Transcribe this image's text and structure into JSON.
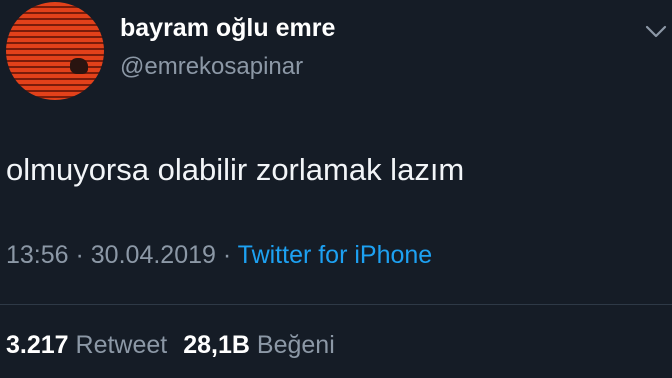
{
  "author": {
    "display_name": "bayram oğlu emre",
    "handle": "@emrekosapinar",
    "avatar_icon": "avatar-image"
  },
  "tweet": {
    "text": "olmuyorsa olabilir zorlamak lazım",
    "time": "13:56",
    "separator": " · ",
    "date": "30.04.2019",
    "source": "Twitter for iPhone"
  },
  "stats": {
    "retweets_count": "3.217",
    "retweets_label": "Retweet",
    "likes_count": "28,1B",
    "likes_label": "Beğeni"
  },
  "colors": {
    "background": "#151c26",
    "link": "#1da1f2",
    "muted": "#8c98a6"
  },
  "icons": {
    "menu": "chevron-down-icon"
  }
}
